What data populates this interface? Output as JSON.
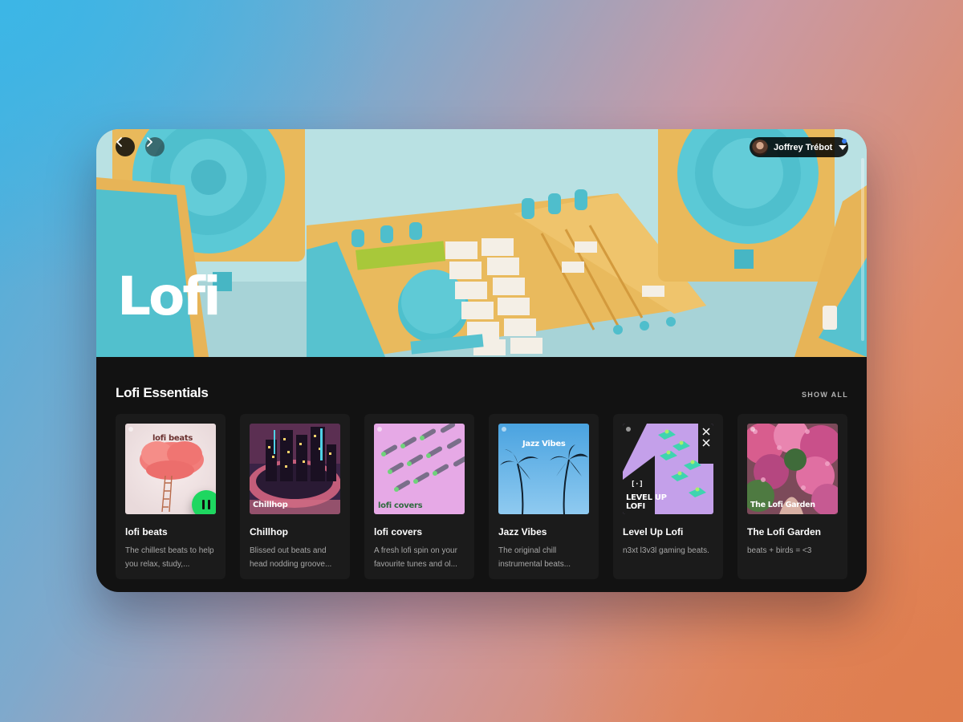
{
  "header": {
    "nav_back_icon": "chevron-left-icon",
    "nav_forward_icon": "chevron-right-icon",
    "user_name": "Joffrey Trébot",
    "notification_color": "#3b7ef0"
  },
  "hero": {
    "title": "Lofi"
  },
  "section": {
    "title": "Lofi Essentials",
    "show_all": "SHOW ALL",
    "cards": [
      {
        "title": "lofi beats",
        "desc": "The chillest beats to help you relax, study,...",
        "cover_text": "lofi beats",
        "playing": true
      },
      {
        "title": "Chillhop",
        "desc": "Blissed out beats and head nodding groove...",
        "cover_text": "Chillhop"
      },
      {
        "title": "lofi covers",
        "desc": "A fresh lofi spin on your favourite tunes and ol...",
        "cover_text": "lofi covers"
      },
      {
        "title": "Jazz Vibes",
        "desc": "The original chill instrumental beats...",
        "cover_text": "Jazz Vibes"
      },
      {
        "title": "Level Up Lofi",
        "desc": "n3xt l3v3l gaming beats.",
        "cover_text": "LEVEL UP\nLOFI",
        "cover_badge": "[·]"
      },
      {
        "title": "The Lofi Garden",
        "desc": "beats + birds = <3",
        "cover_text": "The Lofi Garden"
      }
    ]
  },
  "colors": {
    "accent_green": "#1ed760",
    "window_bg": "#121212",
    "card_bg": "#1b1b1b"
  }
}
